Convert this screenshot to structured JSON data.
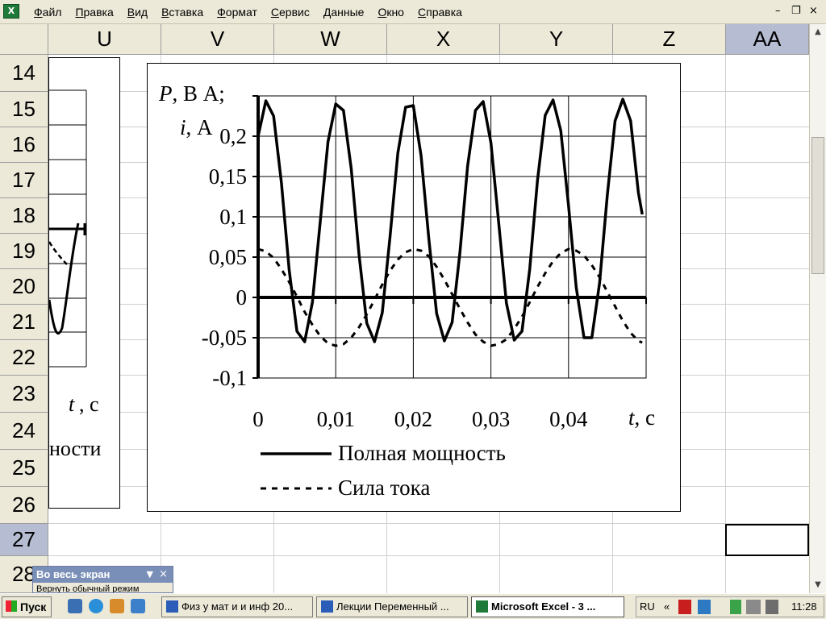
{
  "menu": {
    "icon_letter": "X",
    "items": [
      "Файл",
      "Правка",
      "Вид",
      "Вставка",
      "Формат",
      "Сервис",
      "Данные",
      "Окно",
      "Справка"
    ],
    "minimize": "–",
    "restore": "❐",
    "close": "×"
  },
  "columns": [
    "U",
    "V",
    "W",
    "X",
    "Y",
    "Z",
    "AA"
  ],
  "selected_column": "AA",
  "rows": [
    "14",
    "15",
    "16",
    "17",
    "18",
    "19",
    "20",
    "21",
    "22",
    "23",
    "24",
    "25",
    "26",
    "27",
    "28"
  ],
  "selected_row": "27",
  "left_chart": {
    "xlabel_t": "t",
    "xlabel_unit": ", с",
    "legend_fragment": "ности"
  },
  "chart_data": {
    "type": "line",
    "ylabel_line1_var": "P",
    "ylabel_line1_rest": ", В А;",
    "ylabel_line2_var": "i",
    "ylabel_line2_rest": ", А",
    "xlabel_var": "t",
    "xlabel_rest": ", с",
    "xlim": [
      0,
      0.05
    ],
    "ylim": [
      -0.1,
      0.25
    ],
    "y_ticks": [
      "0,2",
      "0,15",
      "0,1",
      "0,05",
      "0",
      "-0,05",
      "-0,1"
    ],
    "y_tick_values": [
      0.2,
      0.15,
      0.1,
      0.05,
      0,
      -0.05,
      -0.1
    ],
    "x_ticks": [
      "0",
      "0,01",
      "0,02",
      "0,03",
      "0,04"
    ],
    "x_tick_values": [
      0,
      0.01,
      0.02,
      0.03,
      0.04
    ],
    "grid": true,
    "legend_position": "bottom",
    "series": [
      {
        "name": "Полная мощность",
        "style": "solid",
        "x": [
          0,
          0.001,
          0.002,
          0.003,
          0.004,
          0.005,
          0.006,
          0.007,
          0.008,
          0.009,
          0.01,
          0.011,
          0.012,
          0.013,
          0.014,
          0.015,
          0.016,
          0.017,
          0.018,
          0.019,
          0.02,
          0.021,
          0.022,
          0.023,
          0.024,
          0.025,
          0.026,
          0.027,
          0.028,
          0.029,
          0.03,
          0.031,
          0.032,
          0.033,
          0.034,
          0.035,
          0.036,
          0.037,
          0.038,
          0.039,
          0.04,
          0.041,
          0.042,
          0.043,
          0.044,
          0.045,
          0.046,
          0.047,
          0.048,
          0.049,
          0.0495
        ],
        "values": [
          0.2,
          0.244,
          0.225,
          0.142,
          0.034,
          -0.042,
          -0.055,
          -0.006,
          0.094,
          0.193,
          0.24,
          0.232,
          0.16,
          0.053,
          -0.032,
          -0.055,
          -0.019,
          0.075,
          0.179,
          0.236,
          0.238,
          0.176,
          0.073,
          -0.02,
          -0.054,
          -0.031,
          0.055,
          0.163,
          0.232,
          0.243,
          0.192,
          0.093,
          -0.007,
          -0.053,
          -0.042,
          0.035,
          0.145,
          0.226,
          0.245,
          0.207,
          0.114,
          0.012,
          -0.05,
          -0.05,
          0.018,
          0.127,
          0.219,
          0.246,
          0.219,
          0.13,
          0.103
        ]
      },
      {
        "name": "Сила тока",
        "style": "dashed",
        "x": [
          0,
          0.001,
          0.002,
          0.003,
          0.004,
          0.005,
          0.006,
          0.007,
          0.008,
          0.009,
          0.01,
          0.011,
          0.012,
          0.013,
          0.014,
          0.015,
          0.016,
          0.017,
          0.018,
          0.019,
          0.02,
          0.021,
          0.022,
          0.023,
          0.024,
          0.025,
          0.026,
          0.027,
          0.028,
          0.029,
          0.03,
          0.031,
          0.032,
          0.033,
          0.034,
          0.035,
          0.036,
          0.037,
          0.038,
          0.039,
          0.04,
          0.041,
          0.042,
          0.043,
          0.044,
          0.045,
          0.046,
          0.047,
          0.048,
          0.049,
          0.0495
        ],
        "values": [
          0.06,
          0.057,
          0.049,
          0.035,
          0.019,
          0.001,
          -0.018,
          -0.034,
          -0.048,
          -0.057,
          -0.06,
          -0.058,
          -0.05,
          -0.037,
          -0.021,
          -0.003,
          0.016,
          0.033,
          0.047,
          0.056,
          0.06,
          0.058,
          0.051,
          0.038,
          0.022,
          0.004,
          -0.014,
          -0.031,
          -0.046,
          -0.055,
          -0.06,
          -0.058,
          -0.052,
          -0.039,
          -0.024,
          -0.006,
          0.013,
          0.03,
          0.045,
          0.055,
          0.06,
          0.058,
          0.052,
          0.04,
          0.025,
          0.007,
          -0.011,
          -0.029,
          -0.044,
          -0.054,
          -0.056
        ]
      }
    ]
  },
  "fullscreen_toolbar": {
    "title": "Во весь экран",
    "dropdown": "▼",
    "close": "×",
    "body_text": "Вернуть обычный режим"
  },
  "taskbar": {
    "start_label": "Пуск",
    "tasks": [
      "Физ у мат и и инф 20...",
      "Лекции Переменный ...",
      "Microsoft Excel - 3 ..."
    ],
    "language": "RU",
    "chevron": "«",
    "clock": "11:28"
  },
  "colors": {
    "chrome": "#ece9d8",
    "selected_header": "#b6bdd2",
    "gridline": "#d0d0d0"
  }
}
